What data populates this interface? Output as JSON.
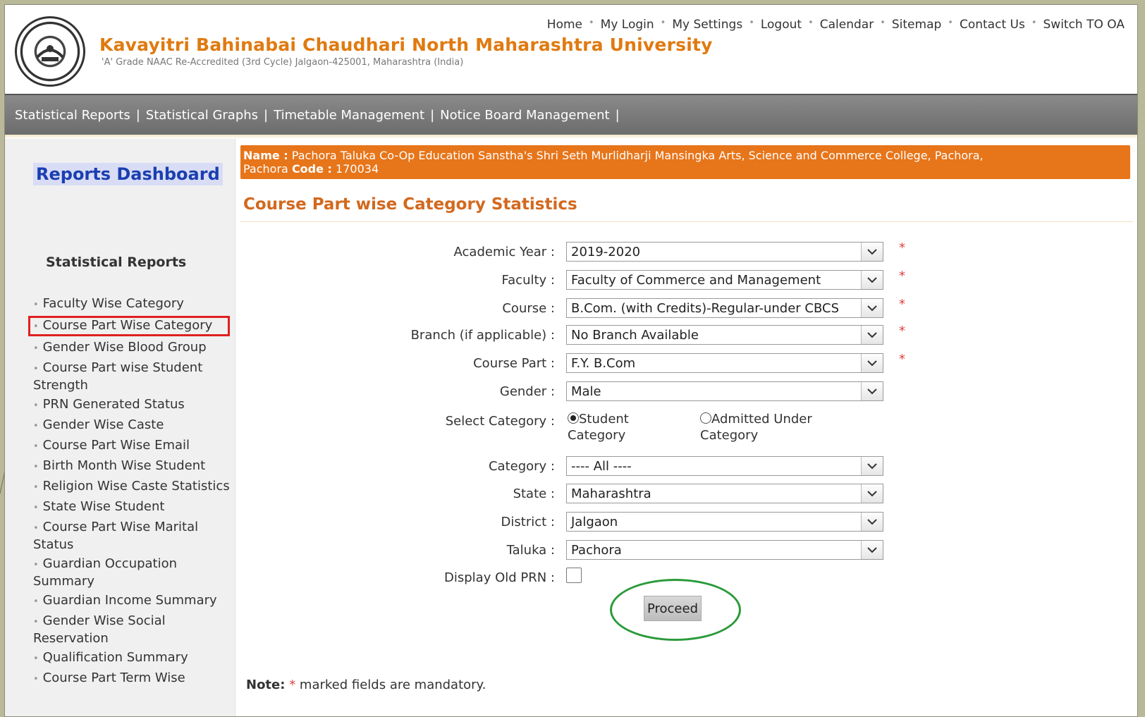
{
  "header": {
    "university_name": "Kavayitri Bahinabai Chaudhari North Maharashtra University",
    "subtitle": "'A' Grade NAAC Re-Accredited (3rd Cycle) Jalgaon-425001, Maharashtra (India)",
    "top_links": [
      "Home",
      "My Login",
      "My Settings",
      "Logout",
      "Calendar",
      "Sitemap",
      "Contact Us",
      "Switch TO OA"
    ],
    "logo_icon": "university-seal-icon"
  },
  "navbar": {
    "items": [
      "Statistical Reports",
      "Statistical Graphs",
      "Timetable Management",
      "Notice Board Management"
    ],
    "separator": "|"
  },
  "sidebar": {
    "dashboard_title": "Reports Dashboard",
    "section_title": "Statistical Reports",
    "items": [
      "Faculty Wise Category",
      "Course Part Wise Category",
      "Gender Wise Blood Group",
      "Course Part wise Student Strength",
      "PRN Generated Status",
      "Gender Wise Caste",
      "Course Part Wise  Email",
      "Birth Month Wise Student",
      "Religion Wise Caste Statistics",
      "State Wise Student",
      "Course Part Wise Marital Status",
      "Guardian Occupation Summary",
      "Guardian Income Summary",
      "Gender Wise Social Reservation",
      "Qualification Summary",
      "Course Part Term Wise"
    ],
    "active_index": 1
  },
  "main": {
    "name_label": "Name :",
    "name_value": "Pachora Taluka Co-Op Education Sanstha's Shri Seth Murlidharji Mansingka Arts, Science and Commerce College, Pachora,",
    "name_value_line2": "Pachora",
    "code_label": "Code :",
    "code_value": "170034",
    "page_title": "Course Part wise Category Statistics"
  },
  "form": {
    "academic_year": {
      "label": "Academic Year :",
      "value": "2019-2020",
      "required": "*"
    },
    "faculty": {
      "label": "Faculty :",
      "value": "Faculty of Commerce and Management",
      "required": "*"
    },
    "course": {
      "label": "Course :",
      "value": "B.Com. (with Credits)-Regular-under CBCS",
      "required": "*"
    },
    "branch": {
      "label": "Branch (if applicable) :",
      "value": "No Branch Available",
      "required": "*"
    },
    "course_part": {
      "label": "Course Part :",
      "value": "F.Y. B.Com",
      "required": "*"
    },
    "gender": {
      "label": "Gender :",
      "value": "Male"
    },
    "select_category": {
      "label": "Select Category :",
      "option1_line1": "Student",
      "option1_line2": "Category",
      "option2_line1": "Admitted Under",
      "option2_line2": "Category",
      "selected": "Student Category"
    },
    "category": {
      "label": "Category :",
      "value": "---- All ----"
    },
    "state": {
      "label": "State :",
      "value": "Maharashtra"
    },
    "district": {
      "label": "District :",
      "value": "Jalgaon"
    },
    "taluka": {
      "label": "Taluka :",
      "value": "Pachora"
    },
    "display_old_prn": {
      "label": "Display Old PRN :",
      "checked": false
    },
    "proceed_label": "Proceed"
  },
  "note": {
    "label": "Note:",
    "star": "*",
    "text": "marked fields are mandatory."
  },
  "colors": {
    "brand_orange": "#e07a10",
    "name_bar": "#e7751a",
    "dashboard_blue": "#1a3fb0",
    "highlight_red": "#e02020",
    "highlight_green": "#2a9a3a"
  }
}
